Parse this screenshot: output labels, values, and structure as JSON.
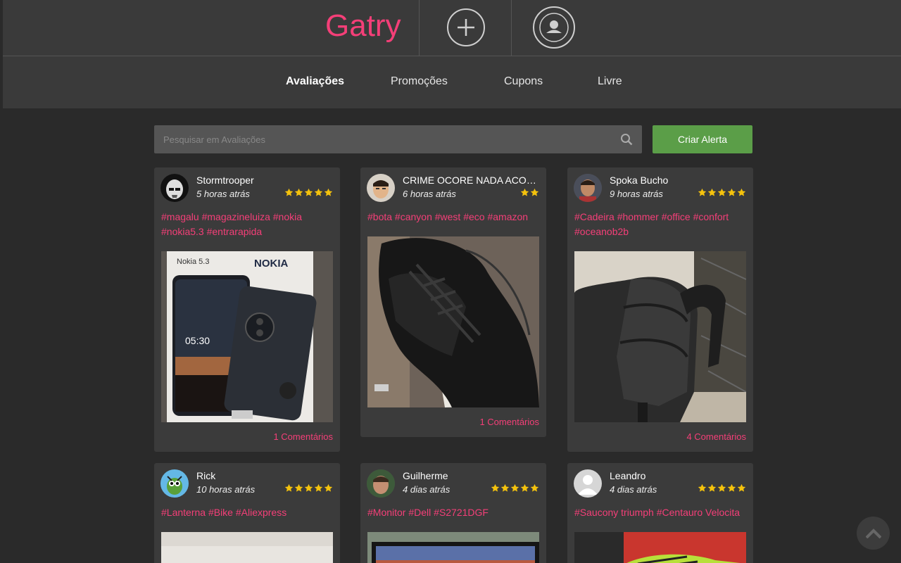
{
  "header": {
    "logo": "Gatry"
  },
  "nav": {
    "items": [
      "Avaliações",
      "Promoções",
      "Cupons",
      "Livre"
    ],
    "active": "Avaliações"
  },
  "search": {
    "placeholder": "Pesquisar em Avaliações",
    "value": ""
  },
  "alert_button": "Criar Alerta",
  "colors": {
    "accent": "#f43f78",
    "star": "#f4c20d",
    "alert": "#5b9e48"
  },
  "cards": [
    {
      "user": "Stormtrooper",
      "time": "5 horas atrás",
      "stars": 5,
      "tags": "#magalu #magazineluiza #nokia #nokia5.3 #entrarapida",
      "comments": "1 Comentários",
      "photo": "nokia-box-photo",
      "photo_text": {
        "model": "Nokia 5.3",
        "brand": "NOKIA",
        "clock": "05:30"
      }
    },
    {
      "user": "CRIME OCORE NADA ACONTECE FEIJOADA",
      "time": "6 horas atrás",
      "stars": 2,
      "tags": "#bota #canyon #west #eco #amazon",
      "comments": "1 Comentários",
      "photo": "black-boots-photo"
    },
    {
      "user": "Spoka Bucho",
      "time": "9 horas atrás",
      "stars": 5,
      "tags": "#Cadeira #hommer #office #confort #oceanob2b",
      "comments": "4 Comentários",
      "photo": "office-chair-photo"
    },
    {
      "user": "Rick",
      "time": "10 horas atrás",
      "stars": 5,
      "tags": "#Lanterna #Bike #Aliexpress",
      "photo": "flashlight-photo"
    },
    {
      "user": "Guilherme",
      "time": "4 dias atrás",
      "stars": 5,
      "tags": "#Monitor #Dell #S2721DGF",
      "photo": "monitor-photo"
    },
    {
      "user": "Leandro",
      "time": "4 dias atrás",
      "stars": 5,
      "tags": "#Saucony triumph #Centauro Velocita",
      "photo": "sneaker-photo"
    }
  ]
}
